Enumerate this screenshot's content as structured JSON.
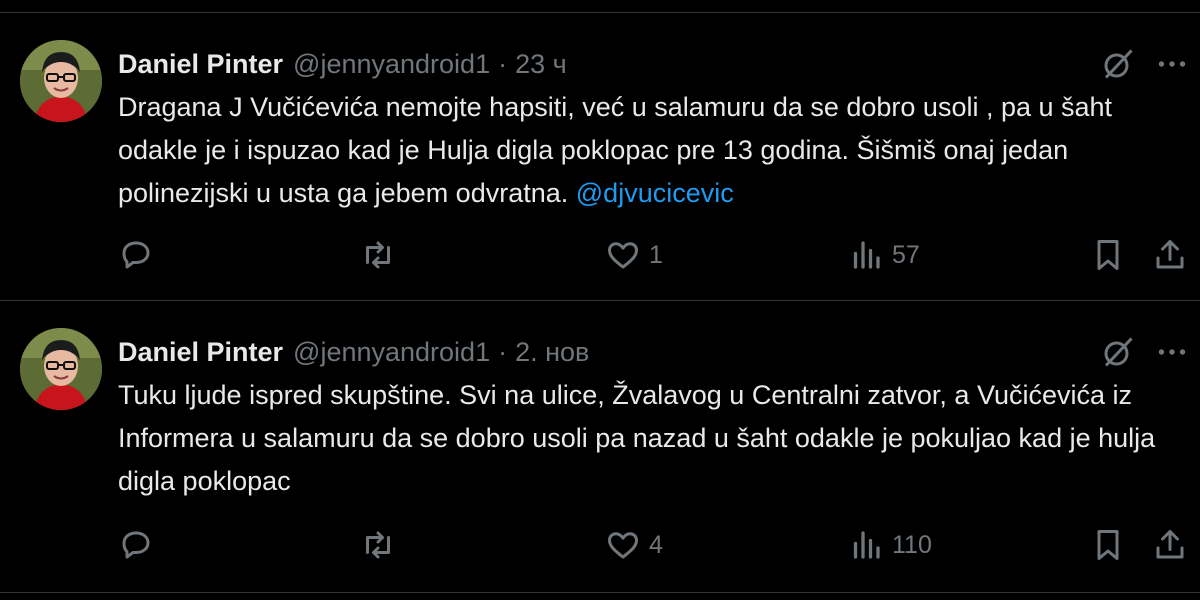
{
  "tweets": [
    {
      "author_name": "Daniel Pinter",
      "handle": "@jennyandroid1",
      "separator": "·",
      "time": "23 ч",
      "text": "Dragana J Vučićevića nemojte hapsiti,  već u salamuru da se dobro usoli , pa u šaht odakle je i ispuzao kad je Hulja digla poklopac pre 13 godina. Šišmiš onaj jedan polinezijski u usta ga jebem odvratna. ",
      "mention": "@djvucicevic",
      "reply_count": "",
      "repost_count": "",
      "like_count": "1",
      "view_count": "57"
    },
    {
      "author_name": "Daniel Pinter",
      "handle": "@jennyandroid1",
      "separator": "·",
      "time": "2. нов",
      "text": "Tuku ljude ispred skupštine.  Svi na ulice, Žvalavog u Centralni zatvor, a Vučićevića iz Informera u salamuru da se dobro usoli pa nazad u šaht odakle je pokuljao kad je hulja digla poklopac",
      "mention": "",
      "reply_count": "",
      "repost_count": "",
      "like_count": "4",
      "view_count": "110"
    }
  ],
  "colors": {
    "background": "#000000",
    "text": "#e7e9ea",
    "muted": "#71767b",
    "link": "#1d9bf0",
    "divider": "#2f3336"
  },
  "icons": [
    "reply-icon",
    "repost-icon",
    "like-icon",
    "views-icon",
    "bookmark-icon",
    "share-icon",
    "grok-icon",
    "more-icon"
  ]
}
